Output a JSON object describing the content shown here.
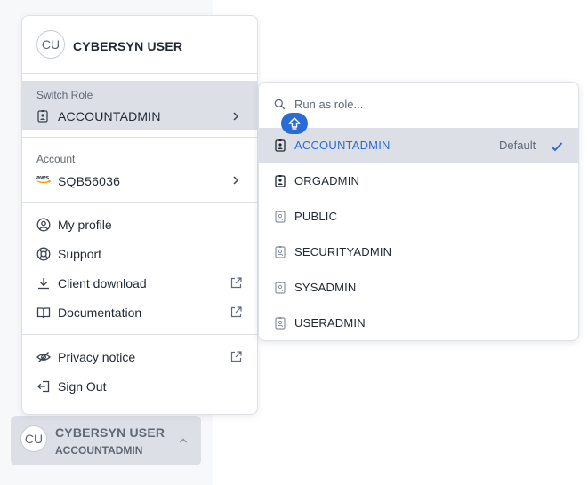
{
  "user": {
    "initials": "CU",
    "name": "CYBERSYN USER",
    "current_role": "ACCOUNTADMIN"
  },
  "menu": {
    "switch_role": {
      "label": "Switch Role",
      "value": "ACCOUNTADMIN",
      "icon": "role-badge-icon"
    },
    "account": {
      "label": "Account",
      "value": "SQB56036",
      "icon": "aws-icon"
    },
    "items": [
      {
        "label": "My profile",
        "icon": "user-circle-icon",
        "external": false
      },
      {
        "label": "Support",
        "icon": "lifebuoy-icon",
        "external": false
      },
      {
        "label": "Client download",
        "icon": "download-icon",
        "external": true
      },
      {
        "label": "Documentation",
        "icon": "book-icon",
        "external": true
      }
    ],
    "footer_items": [
      {
        "label": "Privacy notice",
        "icon": "eye-off-icon",
        "external": true
      },
      {
        "label": "Sign Out",
        "icon": "sign-out-icon",
        "external": false
      }
    ]
  },
  "role_picker": {
    "search_placeholder": "Run as role...",
    "default_label": "Default",
    "roles": [
      {
        "name": "ACCOUNTADMIN",
        "selected": true,
        "is_default": true
      },
      {
        "name": "ORGADMIN",
        "selected": false,
        "is_default": false
      },
      {
        "name": "PUBLIC",
        "selected": false,
        "is_default": false
      },
      {
        "name": "SECURITYADMIN",
        "selected": false,
        "is_default": false
      },
      {
        "name": "SYSADMIN",
        "selected": false,
        "is_default": false
      },
      {
        "name": "USERADMIN",
        "selected": false,
        "is_default": false
      }
    ]
  },
  "colors": {
    "accent": "#2a6cd6",
    "selected_bg": "#dce0e6",
    "text": "#1f2733",
    "muted": "#5f6876"
  }
}
